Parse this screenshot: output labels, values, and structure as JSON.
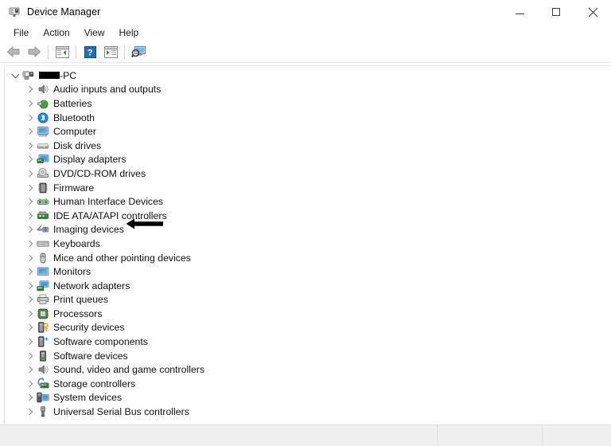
{
  "window": {
    "title": "Device Manager",
    "icon": "device-manager-icon",
    "caption_buttons": [
      {
        "name": "minimize-button",
        "glyph": "minimize-icon"
      },
      {
        "name": "maximize-button",
        "glyph": "maximize-icon"
      },
      {
        "name": "close-button",
        "glyph": "close-icon"
      }
    ]
  },
  "menubar": {
    "items": [
      {
        "label": "File"
      },
      {
        "label": "Action"
      },
      {
        "label": "View"
      },
      {
        "label": "Help"
      }
    ]
  },
  "toolbar": {
    "buttons": [
      {
        "name": "back-button",
        "icon": "back-arrow-icon"
      },
      {
        "name": "forward-button",
        "icon": "forward-arrow-icon"
      },
      {
        "name": "show-hide-console-tree-button",
        "icon": "console-tree-icon"
      },
      {
        "name": "help-button",
        "icon": "question-mark-icon"
      },
      {
        "name": "properties-button",
        "icon": "properties-window-icon"
      },
      {
        "name": "scan-hardware-changes-button",
        "icon": "scan-computer-icon"
      }
    ]
  },
  "tree": {
    "root": {
      "label_suffix": "-PC",
      "redacted": true,
      "icon": "computer-root-icon",
      "expanded": true
    },
    "items": [
      {
        "label": "Audio inputs and outputs",
        "icon": "speaker-icon"
      },
      {
        "label": "Batteries",
        "icon": "battery-icon"
      },
      {
        "label": "Bluetooth",
        "icon": "bluetooth-icon"
      },
      {
        "label": "Computer",
        "icon": "computer-icon"
      },
      {
        "label": "Disk drives",
        "icon": "disk-drive-icon"
      },
      {
        "label": "Display adapters",
        "icon": "display-adapter-icon",
        "annotated": true
      },
      {
        "label": "DVD/CD-ROM drives",
        "icon": "optical-drive-icon"
      },
      {
        "label": "Firmware",
        "icon": "firmware-icon"
      },
      {
        "label": "Human Interface Devices",
        "icon": "hid-icon"
      },
      {
        "label": "IDE ATA/ATAPI controllers",
        "icon": "ide-controller-icon"
      },
      {
        "label": "Imaging devices",
        "icon": "imaging-device-icon"
      },
      {
        "label": "Keyboards",
        "icon": "keyboard-icon"
      },
      {
        "label": "Mice and other pointing devices",
        "icon": "mouse-icon"
      },
      {
        "label": "Monitors",
        "icon": "monitor-icon"
      },
      {
        "label": "Network adapters",
        "icon": "network-adapter-icon"
      },
      {
        "label": "Print queues",
        "icon": "printer-icon"
      },
      {
        "label": "Processors",
        "icon": "processor-icon"
      },
      {
        "label": "Security devices",
        "icon": "security-device-icon"
      },
      {
        "label": "Software components",
        "icon": "software-component-icon"
      },
      {
        "label": "Software devices",
        "icon": "software-device-icon"
      },
      {
        "label": "Sound, video and game controllers",
        "icon": "sound-controller-icon"
      },
      {
        "label": "Storage controllers",
        "icon": "storage-controller-icon"
      },
      {
        "label": "System devices",
        "icon": "system-device-icon"
      },
      {
        "label": "Universal Serial Bus controllers",
        "icon": "usb-controller-icon"
      }
    ]
  },
  "annotation": {
    "type": "arrow",
    "direction": "left",
    "target": "Display adapters",
    "color": "#000000"
  },
  "statusbar": {
    "cells": [
      "",
      "",
      ""
    ]
  },
  "colors": {
    "window_background": "#ffffff",
    "statusbar_background": "#f0f0f0",
    "text": "#101010",
    "chevron": "#8a8a8a",
    "accent_blue": "#1e8ad6",
    "accent_green": "#3a9a3a"
  }
}
